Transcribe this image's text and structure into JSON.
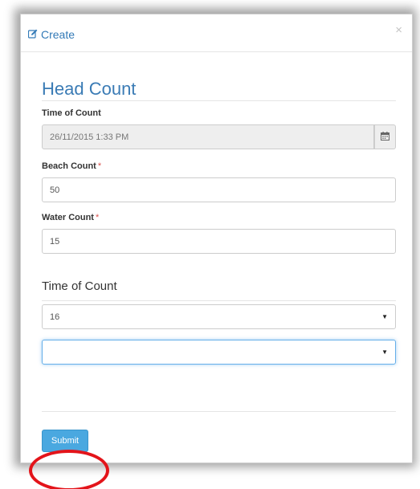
{
  "modal": {
    "title": "Create",
    "close_glyph": "×"
  },
  "form": {
    "section_title": "Head Count",
    "time_of_count": {
      "label": "Time of Count",
      "value": "26/11/2015 1:33 PM",
      "icon": "calendar-icon"
    },
    "beach_count": {
      "label": "Beach Count",
      "required_mark": "*",
      "value": "50"
    },
    "water_count": {
      "label": "Water Count",
      "required_mark": "*",
      "value": "15"
    },
    "subsection_title": "Time of Count",
    "select_one": {
      "value": "16"
    },
    "select_two": {
      "value": ""
    },
    "submit_label": "Submit"
  },
  "colors": {
    "accent": "#337ab7",
    "button": "#4aa8e0",
    "required": "#d9534f",
    "annotation": "#e3141a"
  }
}
